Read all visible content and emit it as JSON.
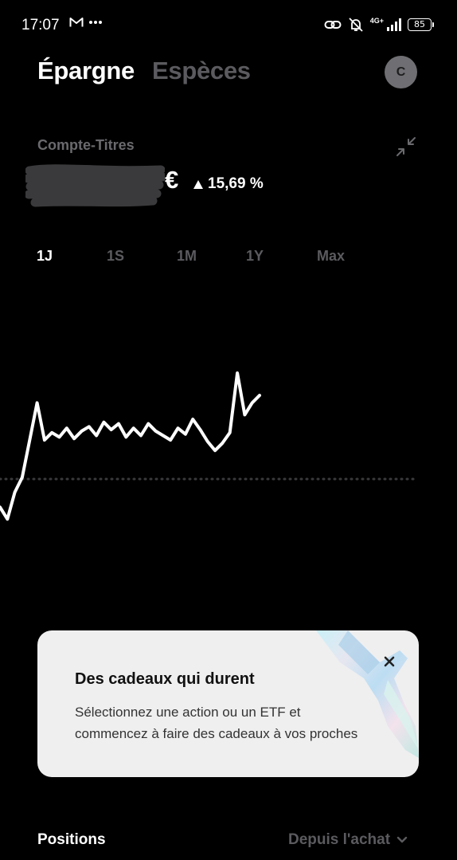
{
  "status_bar": {
    "time": "17:07",
    "network_label": "4G+",
    "battery": "85",
    "icons": [
      "gmail-icon",
      "more-dots-icon",
      "link-icon",
      "bell-off-icon",
      "signal-icon",
      "battery-icon"
    ]
  },
  "header": {
    "tab_active": "Épargne",
    "tab_inactive": "Espèces",
    "avatar_initial": "C"
  },
  "account": {
    "label": "Compte-Titres",
    "balance_currency": "€",
    "performance": "15,69 %",
    "performance_direction": "up"
  },
  "ranges": {
    "items": [
      "1J",
      "1S",
      "1M",
      "1Y",
      "Max"
    ],
    "active": "1J"
  },
  "chart_data": {
    "type": "line",
    "title": "",
    "xlabel": "",
    "ylabel": "",
    "reference_line": "dotted",
    "series": [
      {
        "values": [
          0.1,
          0.02,
          0.2,
          0.3,
          0.55,
          0.8,
          0.55,
          0.6,
          0.57,
          0.63,
          0.56,
          0.61,
          0.64,
          0.58,
          0.67,
          0.62,
          0.66,
          0.57,
          0.63,
          0.58,
          0.66,
          0.61,
          0.58,
          0.55,
          0.63,
          0.59,
          0.69,
          0.62,
          0.54,
          0.48,
          0.53,
          0.6,
          1.0,
          0.72,
          0.8,
          0.85
        ]
      }
    ],
    "colors": {
      "line": "#ffffff",
      "reference": "#3a3a3d"
    }
  },
  "promo": {
    "title": "Des cadeaux qui durent",
    "text_line1": "Sélectionnez une action ou un ETF et",
    "text_line2": "commencez à faire des cadeaux à vos proches"
  },
  "positions": {
    "label": "Positions",
    "sort_label": "Depuis l'achat"
  },
  "colors": {
    "background": "#000000",
    "muted_text": "#5b5b5f",
    "card_background": "#efeff0"
  }
}
